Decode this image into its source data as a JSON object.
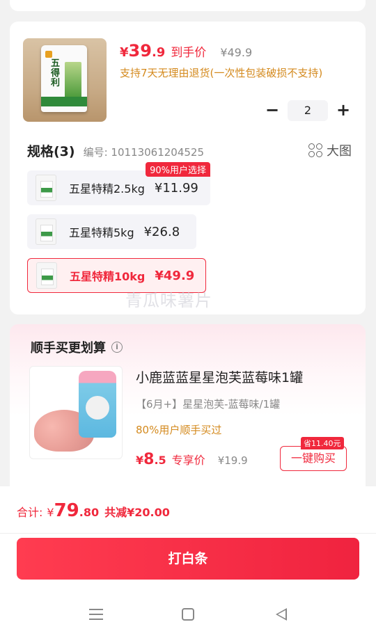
{
  "product": {
    "price_symbol": "¥",
    "price_int": "39",
    "price_dec": ".9",
    "price_label": "到手价",
    "orig_price": "¥49.9",
    "return_policy": "支持7天无理由退货(一次性包装破损不支持)",
    "thumb_name": "五得利",
    "quantity": "2",
    "qty_minus": "−",
    "qty_plus": "+"
  },
  "spec": {
    "title": "规格(3)",
    "code": "编号: 10113061204525",
    "big_image_label": "大图",
    "options": [
      {
        "name": "五星特精2.5kg",
        "price": "¥11.99",
        "badge": "90%用户选择",
        "selected": false
      },
      {
        "name": "五星特精5kg",
        "price": "¥26.8",
        "selected": false
      },
      {
        "name": "五星特精10kg",
        "price": "¥49.9",
        "selected": true
      }
    ]
  },
  "watermark": "青瓜味薯片",
  "bundle": {
    "title": "顺手买更划算",
    "info_icon": "i",
    "item_name": "小鹿蓝蓝星星泡芙蓝莓味1罐",
    "item_spec": "【6月+】星星泡芙-蓝莓味/1罐",
    "social_proof": "80%用户顺手买过",
    "price_symbol": "¥",
    "price_int": "8",
    "price_dec": ".5",
    "price_label": "专享价",
    "orig_price": "¥19.9",
    "buy_label": "一键购买",
    "save_badge": "省11.40元"
  },
  "checkout": {
    "total_label": "合计:",
    "total_symbol": "¥",
    "total_int": "79",
    "total_dec": ".80",
    "discount_text": "共减¥20.00",
    "pay_button": "打白条"
  },
  "colors": {
    "accent": "#f0283c",
    "orange_text": "#d48a1e"
  }
}
